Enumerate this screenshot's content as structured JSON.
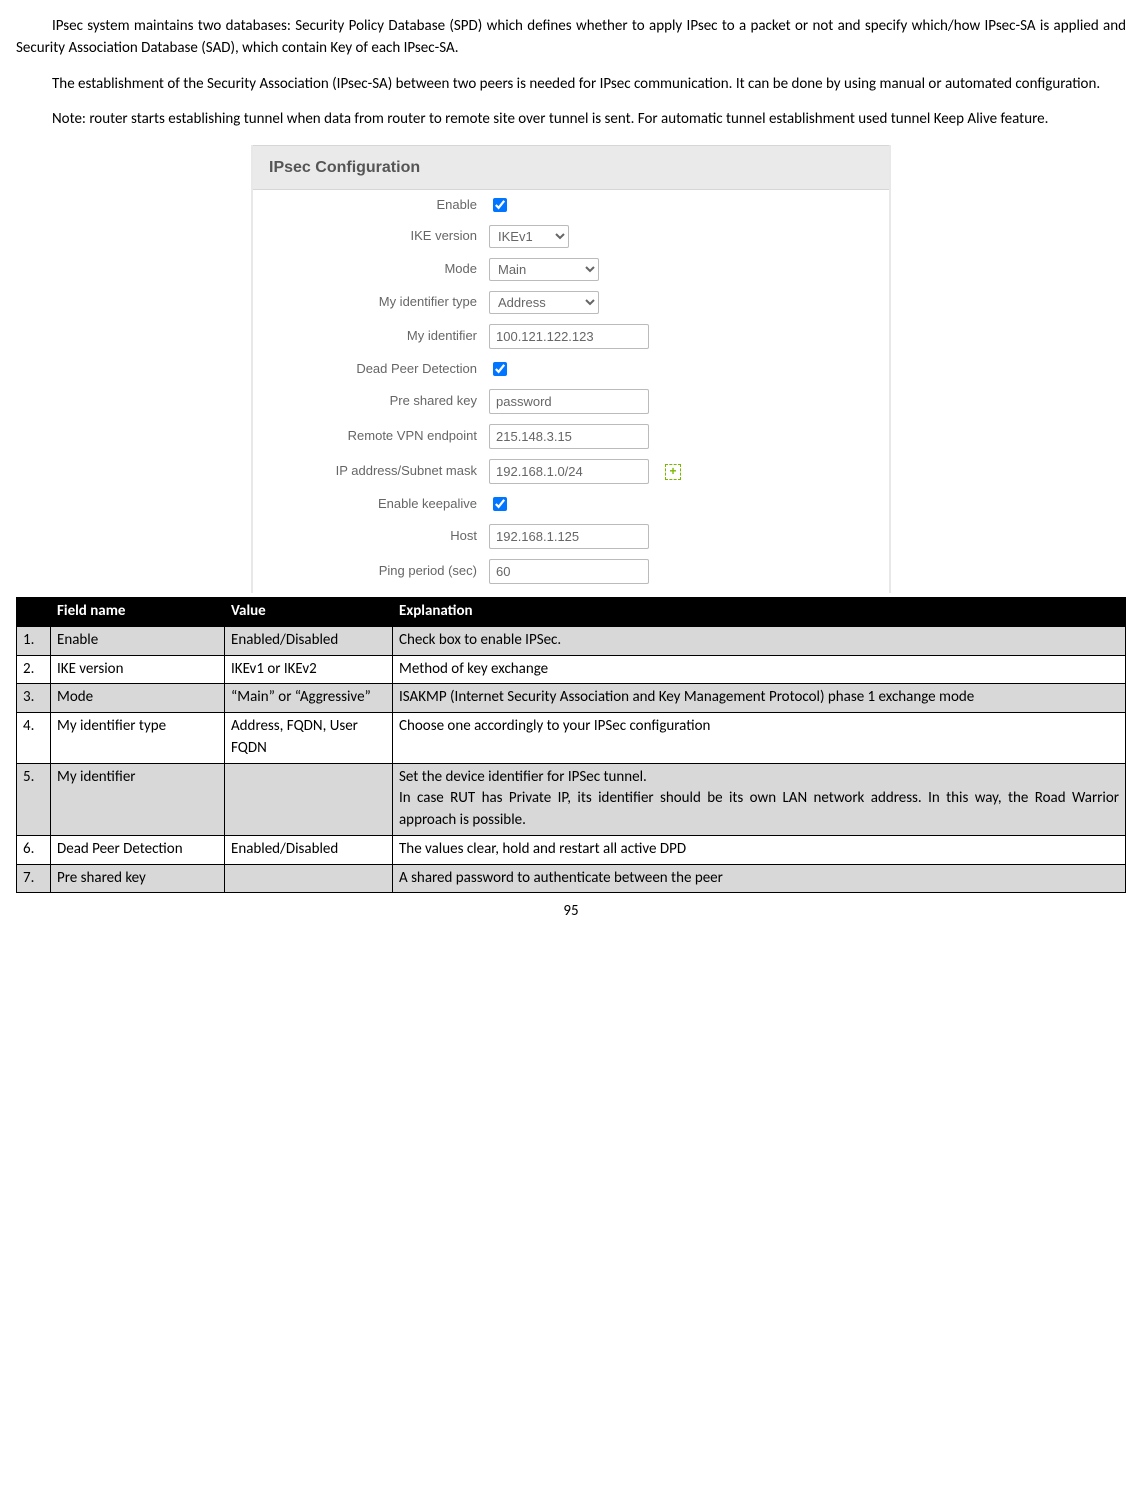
{
  "paragraphs": {
    "p1": "IPsec system maintains two databases: Security Policy Database (SPD) which defines whether to apply IPsec to a packet or not and specify which/how IPsec-SA is applied and Security Association Database (SAD), which contain Key of each IPsec-SA.",
    "p2": "The establishment of the Security Association (IPsec-SA) between two peers is needed for IPsec communication. It can be done by using manual or automated configuration.",
    "p3": "Note: router starts establishing tunnel when data from router to remote site over tunnel is sent. For automatic tunnel establishment used tunnel Keep Alive feature."
  },
  "ui": {
    "header": "IPsec Configuration",
    "labels": {
      "enable": "Enable",
      "ike": "IKE version",
      "mode": "Mode",
      "idtype": "My identifier type",
      "id": "My identifier",
      "dpd": "Dead Peer Detection",
      "psk": "Pre shared key",
      "remote": "Remote VPN endpoint",
      "subnet": "IP address/Subnet mask",
      "keepalive": "Enable keepalive",
      "host": "Host",
      "ping": "Ping period (sec)"
    },
    "values": {
      "ike": "IKEv1",
      "mode": "Main",
      "idtype": "Address",
      "id": "100.121.122.123",
      "psk": "password",
      "remote": "215.148.3.15",
      "subnet": "192.168.1.0/24",
      "host": "192.168.1.125",
      "ping": "60"
    }
  },
  "table": {
    "headers": {
      "num": "",
      "field": "Field name",
      "value": "Value",
      "exp": "Explanation"
    },
    "rows": [
      {
        "num": "1.",
        "field": "Enable",
        "value": "Enabled/Disabled",
        "exp": "Check box to enable IPSec."
      },
      {
        "num": "2.",
        "field": "IKE version",
        "value": "IKEv1 or IKEv2",
        "exp": "Method of key exchange"
      },
      {
        "num": "3.",
        "field": "Mode",
        "value": "“Main” or “Aggressive”",
        "exp": "ISAKMP (Internet Security Association and Key Management Protocol) phase 1 exchange mode"
      },
      {
        "num": "4.",
        "field": "My identifier type",
        "value": "Address, FQDN, User FQDN",
        "exp": "Choose one accordingly to your IPSec configuration"
      },
      {
        "num": "5.",
        "field": "My identifier",
        "value": "",
        "exp": "Set the device identifier for IPSec tunnel.\nIn case RUT has Private IP, its identifier should be its own LAN network address. In this way, the Road Warrior approach is possible."
      },
      {
        "num": "6.",
        "field": "Dead Peer Detection",
        "value": "Enabled/Disabled",
        "exp": "The values clear, hold and restart all active DPD"
      },
      {
        "num": "7.",
        "field": "Pre shared key",
        "value": "",
        "exp": "A shared password to authenticate between the peer"
      }
    ]
  },
  "page_number": "95"
}
